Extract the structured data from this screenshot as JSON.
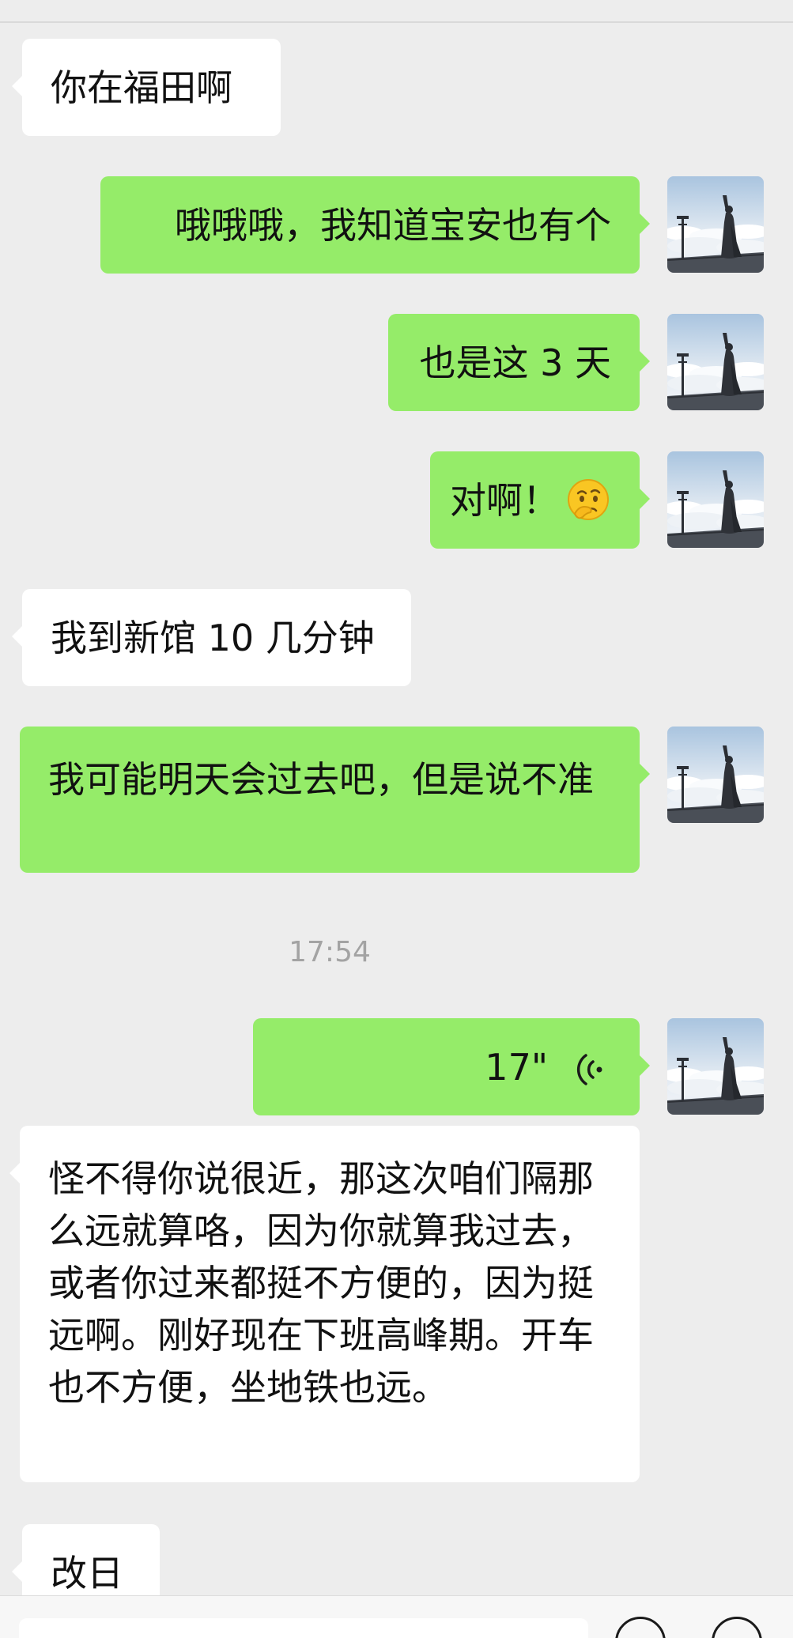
{
  "messages": [
    {
      "side": "in",
      "text": "你在福田啊"
    },
    {
      "side": "out",
      "text": "哦哦哦，我知道宝安也有个"
    },
    {
      "side": "out",
      "text": "也是这 3 天"
    },
    {
      "side": "out",
      "text": "对啊！",
      "emoji": "thinking-face-icon"
    },
    {
      "side": "in",
      "text": "我到新馆 10 几分钟"
    },
    {
      "side": "out",
      "text": "我可能明天会过去吧，但是说不准"
    },
    {
      "side": "out",
      "type": "voice",
      "duration": "17\""
    },
    {
      "side": "in",
      "text": "怪不得你说很近，那这次咱们隔那么远就算咯，因为你就算我过去，或者你过来都挺不方便的，因为挺远啊。刚好现在下班高峰期。开车也不方便，坐地铁也远。"
    },
    {
      "side": "in",
      "text": "改日"
    }
  ],
  "timestamp": "17:54",
  "colors": {
    "background": "#ededed",
    "incoming_bubble": "#ffffff",
    "outgoing_bubble": "#95ec69",
    "timestamp_text": "#a3a3a3"
  },
  "icons": {
    "avatar": "avatar-woman-above-clouds",
    "voice": "voice-wave-icon",
    "emoji": "thinking-face-icon"
  }
}
